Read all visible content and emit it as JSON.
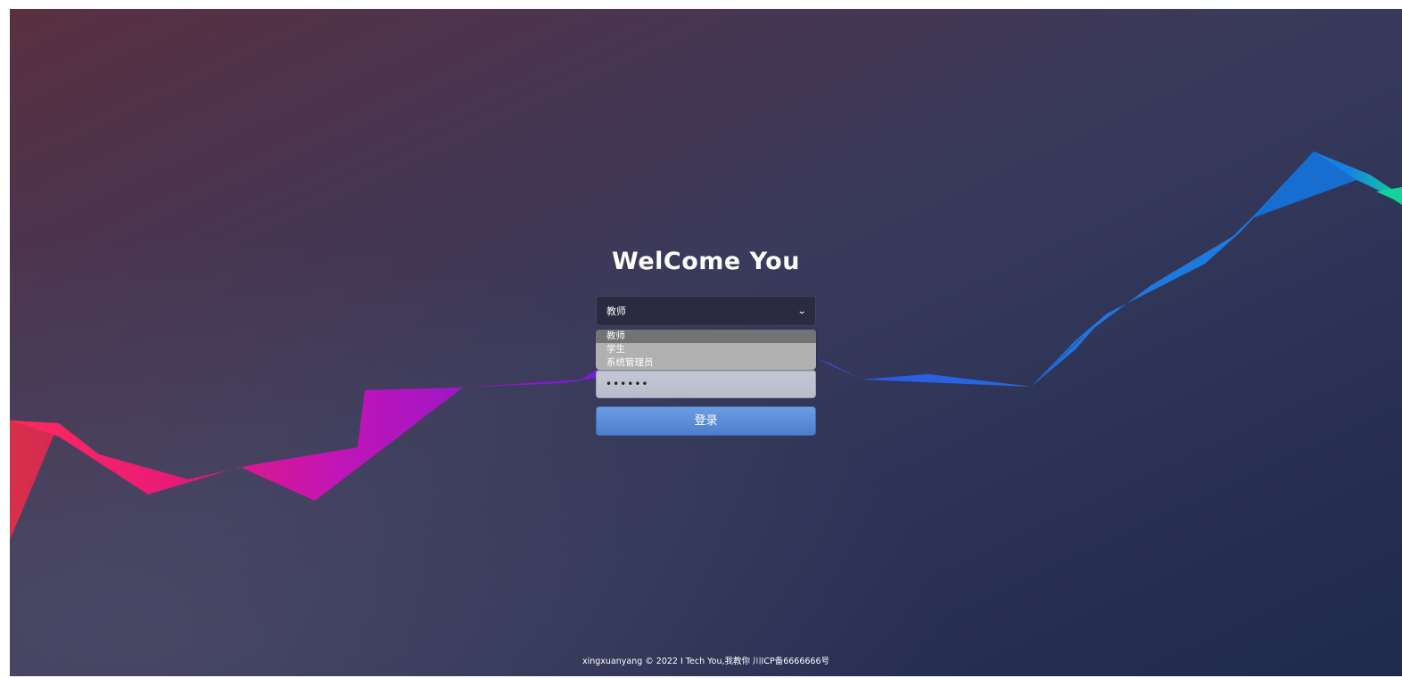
{
  "page": {
    "title": "WelCome You"
  },
  "login_form": {
    "role_select": {
      "value": "教师",
      "options": [
        "教师",
        "学生",
        "系统管理员"
      ],
      "highlighted_option": "教师"
    },
    "password": {
      "masked_value": "••••••"
    },
    "submit_label": "登录"
  },
  "footer": {
    "text": "xingxuanyang © 2022 I Tech You,我教你 川ICP备6666666号"
  },
  "colors": {
    "background_top_left": "#5a3040",
    "background_bottom_right": "#1f2a4e",
    "select_background": "#2a2a40",
    "dropdown_background": "#b0b0b0",
    "dropdown_highlight": "#737373",
    "button_blue": "#5b8ed6",
    "ribbon_red": "#ff2a5a",
    "ribbon_magenta": "#c015b8",
    "ribbon_purple": "#7a1ed8",
    "ribbon_blue": "#1f78e0",
    "ribbon_green": "#13d39a"
  },
  "icons": {
    "select_chevron": "chevron-down-icon"
  }
}
